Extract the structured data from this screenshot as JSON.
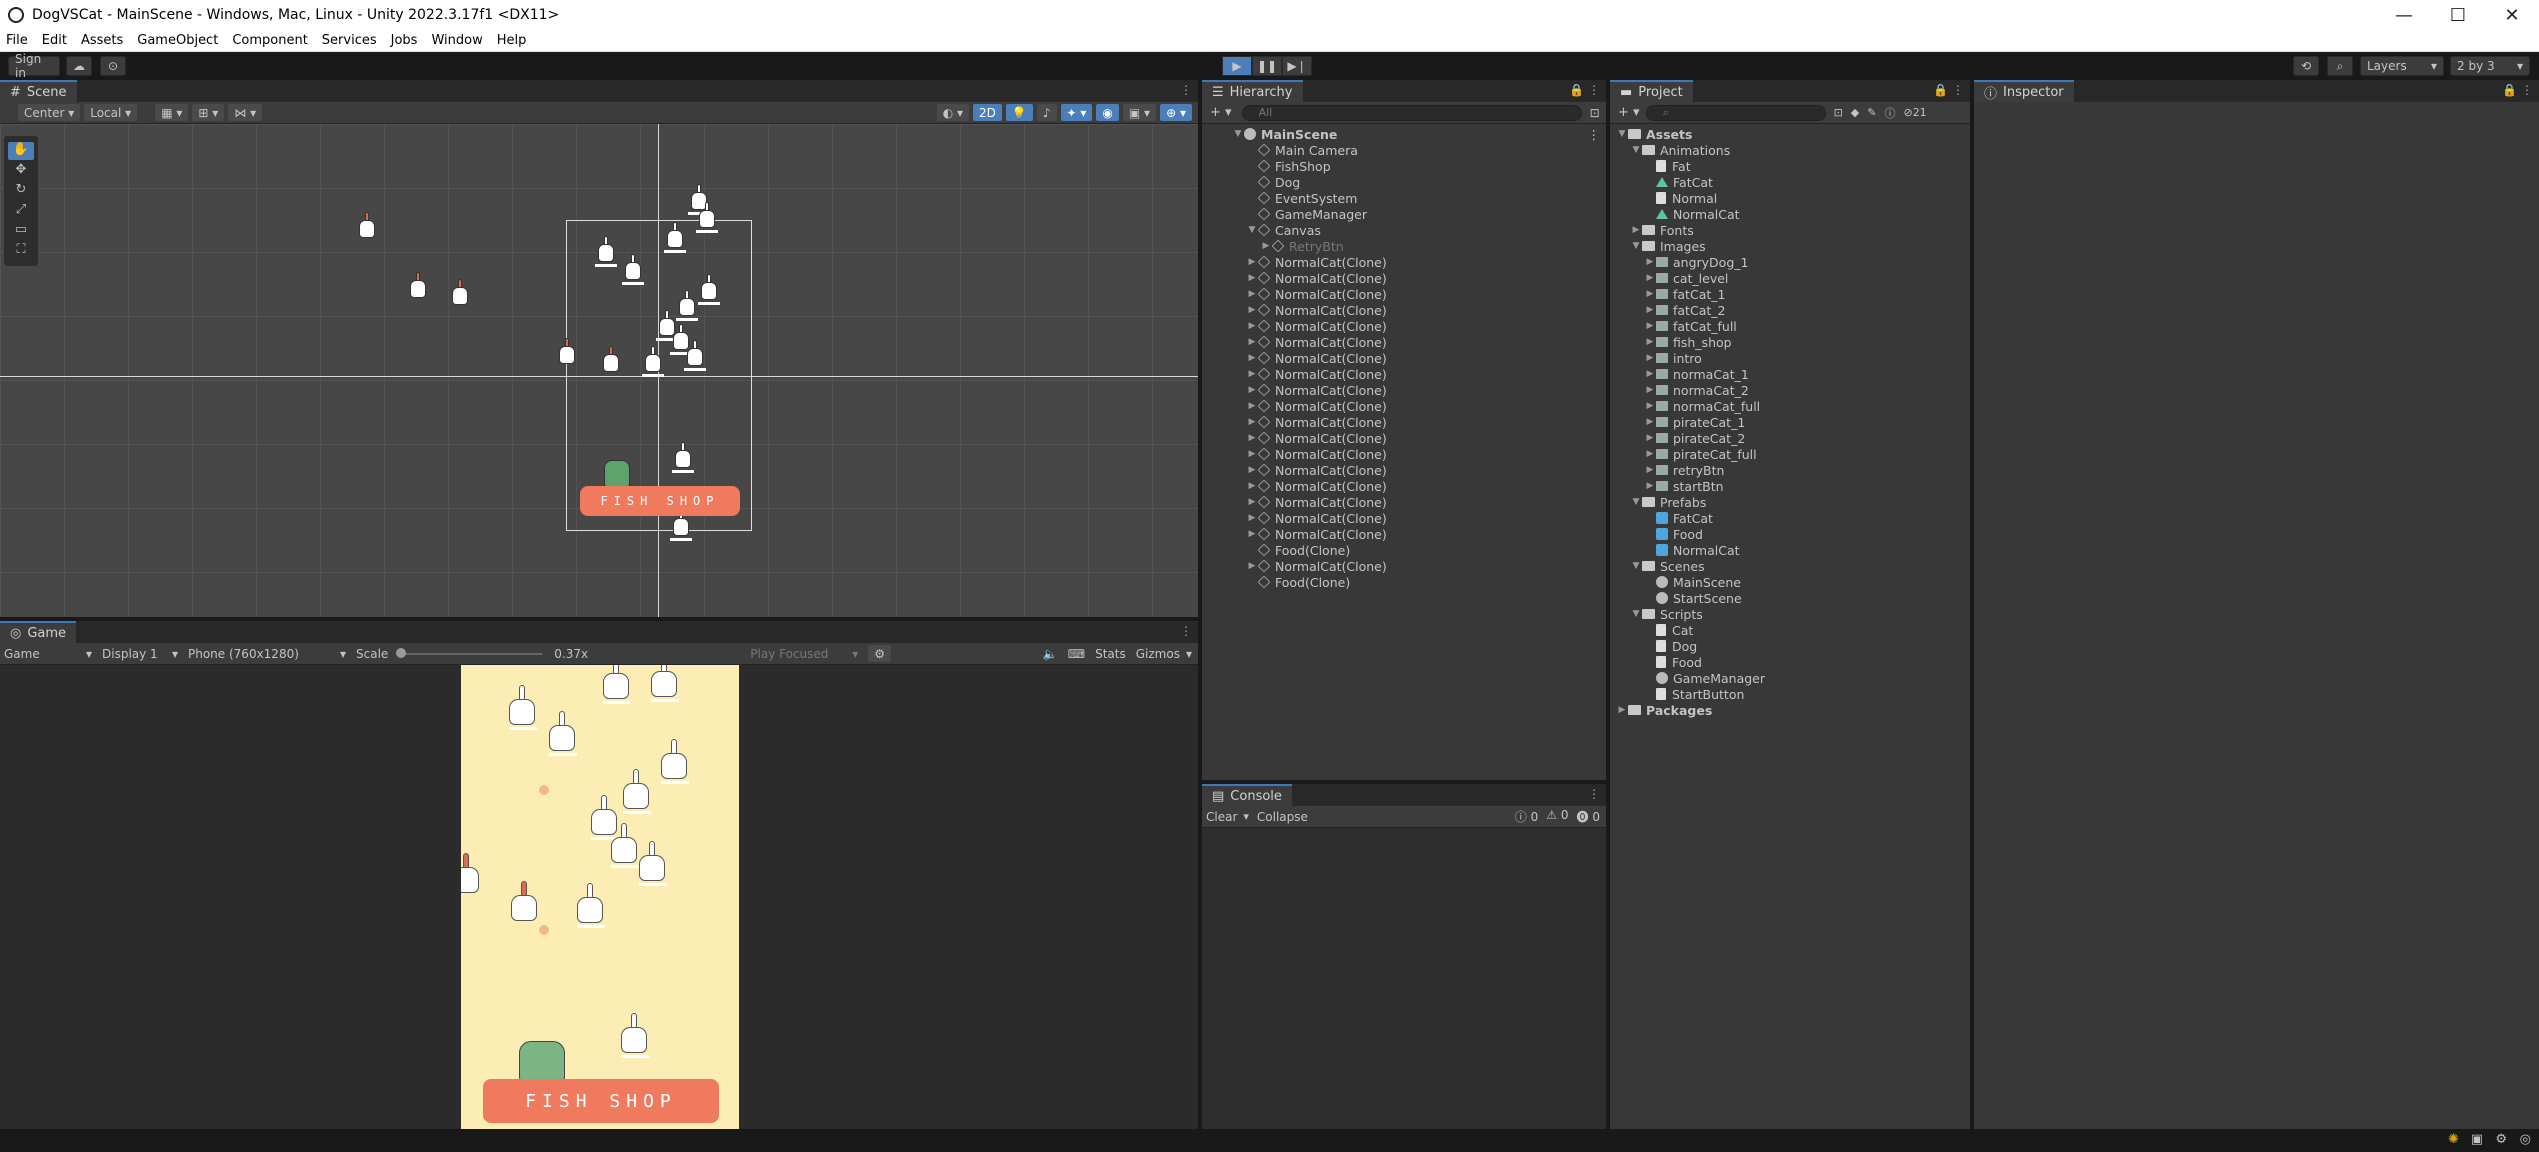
{
  "window": {
    "title": "DogVSCat - MainScene - Windows, Mac, Linux - Unity 2022.3.17f1 <DX11>"
  },
  "menu": [
    "File",
    "Edit",
    "Assets",
    "GameObject",
    "Component",
    "Services",
    "Jobs",
    "Window",
    "Help"
  ],
  "toolbar": {
    "sign_in": "Sign in",
    "layers": "Layers",
    "layout": "2 by 3"
  },
  "scene": {
    "tab": "Scene",
    "pivot": "Center",
    "space": "Local",
    "mode_2d": "2D",
    "sign_text": "FISH SHOP"
  },
  "game": {
    "tab": "Game",
    "mode": "Game",
    "display": "Display 1",
    "resolution": "Phone (760x1280)",
    "scale_label": "Scale",
    "scale_value": "0.37x",
    "play_focused": "Play Focused",
    "stats": "Stats",
    "gizmos": "Gizmos",
    "sign_text": "FISH SHOP"
  },
  "hierarchy": {
    "tab": "Hierarchy",
    "search_placeholder": "All",
    "root": "MainScene",
    "items": [
      {
        "label": "Main Camera",
        "depth": 1,
        "arrow": ""
      },
      {
        "label": "FishShop",
        "depth": 1,
        "arrow": ""
      },
      {
        "label": "Dog",
        "depth": 1,
        "arrow": ""
      },
      {
        "label": "EventSystem",
        "depth": 1,
        "arrow": ""
      },
      {
        "label": "GameManager",
        "depth": 1,
        "arrow": ""
      },
      {
        "label": "Canvas",
        "depth": 1,
        "arrow": "▼"
      },
      {
        "label": "RetryBtn",
        "depth": 2,
        "arrow": "▶",
        "dim": true
      },
      {
        "label": "NormalCat(Clone)",
        "depth": 1,
        "arrow": "▶"
      },
      {
        "label": "NormalCat(Clone)",
        "depth": 1,
        "arrow": "▶"
      },
      {
        "label": "NormalCat(Clone)",
        "depth": 1,
        "arrow": "▶"
      },
      {
        "label": "NormalCat(Clone)",
        "depth": 1,
        "arrow": "▶"
      },
      {
        "label": "NormalCat(Clone)",
        "depth": 1,
        "arrow": "▶"
      },
      {
        "label": "NormalCat(Clone)",
        "depth": 1,
        "arrow": "▶"
      },
      {
        "label": "NormalCat(Clone)",
        "depth": 1,
        "arrow": "▶"
      },
      {
        "label": "NormalCat(Clone)",
        "depth": 1,
        "arrow": "▶"
      },
      {
        "label": "NormalCat(Clone)",
        "depth": 1,
        "arrow": "▶"
      },
      {
        "label": "NormalCat(Clone)",
        "depth": 1,
        "arrow": "▶"
      },
      {
        "label": "NormalCat(Clone)",
        "depth": 1,
        "arrow": "▶"
      },
      {
        "label": "NormalCat(Clone)",
        "depth": 1,
        "arrow": "▶"
      },
      {
        "label": "NormalCat(Clone)",
        "depth": 1,
        "arrow": "▶"
      },
      {
        "label": "NormalCat(Clone)",
        "depth": 1,
        "arrow": "▶"
      },
      {
        "label": "NormalCat(Clone)",
        "depth": 1,
        "arrow": "▶"
      },
      {
        "label": "NormalCat(Clone)",
        "depth": 1,
        "arrow": "▶"
      },
      {
        "label": "NormalCat(Clone)",
        "depth": 1,
        "arrow": "▶"
      },
      {
        "label": "NormalCat(Clone)",
        "depth": 1,
        "arrow": "▶"
      },
      {
        "label": "Food(Clone)",
        "depth": 1,
        "arrow": ""
      },
      {
        "label": "NormalCat(Clone)",
        "depth": 1,
        "arrow": "▶"
      },
      {
        "label": "Food(Clone)",
        "depth": 1,
        "arrow": ""
      }
    ]
  },
  "console": {
    "tab": "Console",
    "clear": "Clear",
    "collapse": "Collapse",
    "info_count": "0",
    "warn_count": "0",
    "error_count": "0"
  },
  "project": {
    "tab": "Project",
    "hidden_count": "21",
    "items": [
      {
        "label": "Assets",
        "depth": 0,
        "arrow": "▼",
        "icon": "folder",
        "bold": true
      },
      {
        "label": "Animations",
        "depth": 1,
        "arrow": "▼",
        "icon": "folder"
      },
      {
        "label": "Fat",
        "depth": 2,
        "arrow": "",
        "icon": "file"
      },
      {
        "label": "FatCat",
        "depth": 2,
        "arrow": "",
        "icon": "anim"
      },
      {
        "label": "Normal",
        "depth": 2,
        "arrow": "",
        "icon": "file"
      },
      {
        "label": "NormalCat",
        "depth": 2,
        "arrow": "",
        "icon": "anim"
      },
      {
        "label": "Fonts",
        "depth": 1,
        "arrow": "▶",
        "icon": "folder"
      },
      {
        "label": "Images",
        "depth": 1,
        "arrow": "▼",
        "icon": "folder"
      },
      {
        "label": "angryDog_1",
        "depth": 2,
        "arrow": "▶",
        "icon": "img"
      },
      {
        "label": "cat_level",
        "depth": 2,
        "arrow": "▶",
        "icon": "img"
      },
      {
        "label": "fatCat_1",
        "depth": 2,
        "arrow": "▶",
        "icon": "img"
      },
      {
        "label": "fatCat_2",
        "depth": 2,
        "arrow": "▶",
        "icon": "img"
      },
      {
        "label": "fatCat_full",
        "depth": 2,
        "arrow": "▶",
        "icon": "img"
      },
      {
        "label": "fish_shop",
        "depth": 2,
        "arrow": "▶",
        "icon": "img"
      },
      {
        "label": "intro",
        "depth": 2,
        "arrow": "▶",
        "icon": "img"
      },
      {
        "label": "normaCat_1",
        "depth": 2,
        "arrow": "▶",
        "icon": "img"
      },
      {
        "label": "normaCat_2",
        "depth": 2,
        "arrow": "▶",
        "icon": "img"
      },
      {
        "label": "normaCat_full",
        "depth": 2,
        "arrow": "▶",
        "icon": "img"
      },
      {
        "label": "pirateCat_1",
        "depth": 2,
        "arrow": "▶",
        "icon": "img"
      },
      {
        "label": "pirateCat_2",
        "depth": 2,
        "arrow": "▶",
        "icon": "img"
      },
      {
        "label": "pirateCat_full",
        "depth": 2,
        "arrow": "▶",
        "icon": "img"
      },
      {
        "label": "retryBtn",
        "depth": 2,
        "arrow": "▶",
        "icon": "img"
      },
      {
        "label": "startBtn",
        "depth": 2,
        "arrow": "▶",
        "icon": "img"
      },
      {
        "label": "Prefabs",
        "depth": 1,
        "arrow": "▼",
        "icon": "folder"
      },
      {
        "label": "FatCat",
        "depth": 2,
        "arrow": "",
        "icon": "prefab"
      },
      {
        "label": "Food",
        "depth": 2,
        "arrow": "",
        "icon": "prefab"
      },
      {
        "label": "NormalCat",
        "depth": 2,
        "arrow": "",
        "icon": "prefab"
      },
      {
        "label": "Scenes",
        "depth": 1,
        "arrow": "▼",
        "icon": "folder"
      },
      {
        "label": "MainScene",
        "depth": 2,
        "arrow": "",
        "icon": "scene"
      },
      {
        "label": "StartScene",
        "depth": 2,
        "arrow": "",
        "icon": "scene"
      },
      {
        "label": "Scripts",
        "depth": 1,
        "arrow": "▼",
        "icon": "folder"
      },
      {
        "label": "Cat",
        "depth": 2,
        "arrow": "",
        "icon": "file"
      },
      {
        "label": "Dog",
        "depth": 2,
        "arrow": "",
        "icon": "file"
      },
      {
        "label": "Food",
        "depth": 2,
        "arrow": "",
        "icon": "file"
      },
      {
        "label": "GameManager",
        "depth": 2,
        "arrow": "",
        "icon": "scene"
      },
      {
        "label": "StartButton",
        "depth": 2,
        "arrow": "",
        "icon": "file"
      },
      {
        "label": "Packages",
        "depth": 0,
        "arrow": "▶",
        "icon": "folder",
        "bold": true
      }
    ]
  },
  "inspector": {
    "tab": "Inspector"
  }
}
